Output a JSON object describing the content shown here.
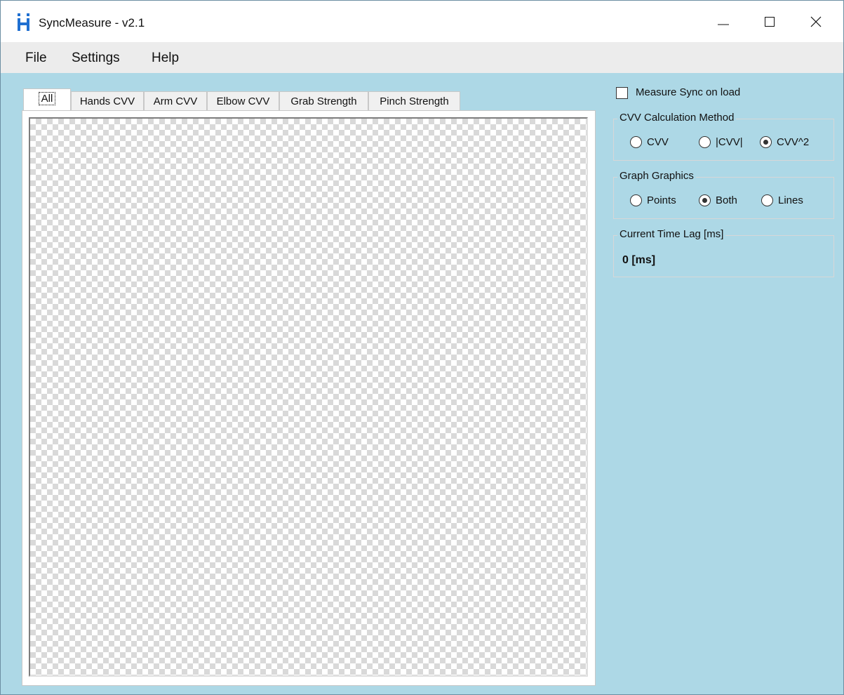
{
  "window": {
    "title": "SyncMeasure - v2.1",
    "icon": "app-logo-icon"
  },
  "menu": {
    "items": [
      "File",
      "Settings",
      "Help"
    ]
  },
  "tabs": [
    {
      "label": "All",
      "active": true
    },
    {
      "label": "Hands CVV",
      "active": false
    },
    {
      "label": "Arm CVV",
      "active": false
    },
    {
      "label": "Elbow CVV",
      "active": false
    },
    {
      "label": "Grab Strength",
      "active": false
    },
    {
      "label": "Pinch Strength",
      "active": false
    }
  ],
  "options": {
    "measure_sync": {
      "label": "Measure Sync on load",
      "checked": false
    }
  },
  "cvv_method": {
    "title": "CVV Calculation Method",
    "options": [
      {
        "label": "CVV",
        "checked": false
      },
      {
        "label": "|CVV|",
        "checked": false
      },
      {
        "label": "CVV^2",
        "checked": true
      }
    ]
  },
  "graph_graphics": {
    "title": "Graph Graphics",
    "options": [
      {
        "label": "Points",
        "checked": false
      },
      {
        "label": "Both",
        "checked": true
      },
      {
        "label": "Lines",
        "checked": false
      }
    ]
  },
  "time_lag": {
    "title": "Current Time Lag [ms]",
    "value": "0 [ms]"
  }
}
